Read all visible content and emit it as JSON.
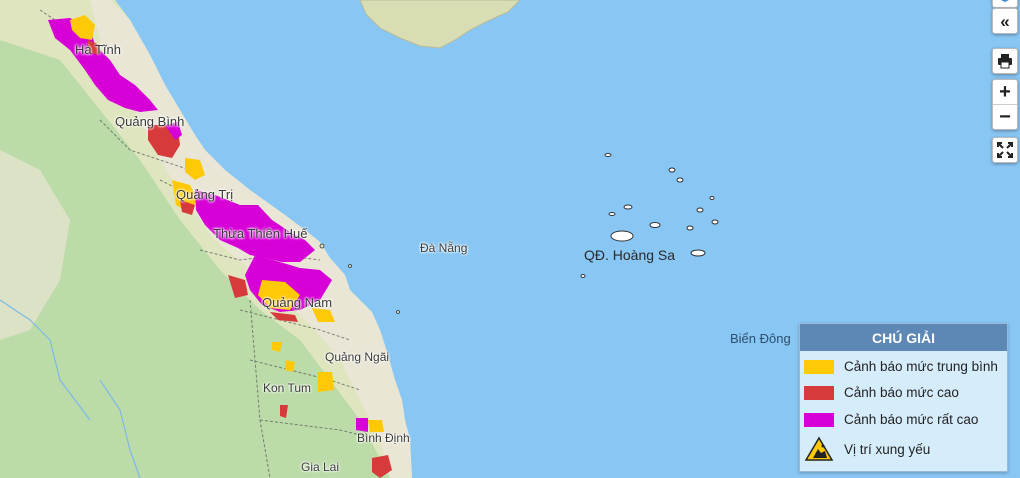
{
  "map": {
    "place_labels": [
      {
        "id": "ha-tinh",
        "text": "Hà Tĩnh"
      },
      {
        "id": "quang-binh",
        "text": "Quảng Bình"
      },
      {
        "id": "quang-tri",
        "text": "Quảng Trị"
      },
      {
        "id": "thua-thien-hue",
        "text": "Thừa Thiên Huế"
      },
      {
        "id": "da-nang",
        "text": "Đà Nẵng"
      },
      {
        "id": "quang-nam",
        "text": "Quảng Nam"
      },
      {
        "id": "quang-ngai",
        "text": "Quảng Ngãi"
      },
      {
        "id": "kon-tum",
        "text": "Kon Tum"
      },
      {
        "id": "binh-dinh",
        "text": "Bình Định"
      },
      {
        "id": "gia-lai",
        "text": "Gia Lai"
      },
      {
        "id": "hoang-sa",
        "text": "QĐ. Hoàng Sa"
      },
      {
        "id": "bien-dong",
        "text": "Biển Đông"
      }
    ],
    "colors": {
      "sea": "#88c6f4",
      "land": "#eae6d3",
      "forest": "#b9dcaa",
      "warning_medium": "#ffc907",
      "warning_high": "#d63a3a",
      "warning_very_high": "#d700d7"
    }
  },
  "controls": {
    "collapse_icon": "chevrons-left-icon",
    "print_icon": "printer-icon",
    "zoom_in_label": "+",
    "zoom_out_label": "−",
    "fullscreen_icon": "expand-icon"
  },
  "legend": {
    "title": "CHÚ GIẢI",
    "items": [
      {
        "label": "Cảnh báo mức trung bình",
        "color": "#ffc907"
      },
      {
        "label": "Cảnh báo mức cao",
        "color": "#d63a3a"
      },
      {
        "label": "Cảnh báo mức rất cao",
        "color": "#d700d7"
      },
      {
        "label": "Vị trí xung yếu",
        "icon": "landslide-warning-icon"
      }
    ]
  }
}
